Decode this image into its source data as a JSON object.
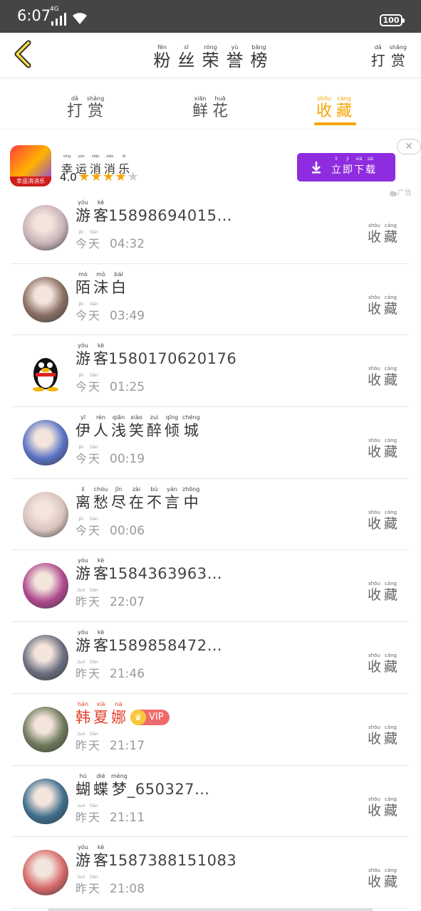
{
  "status_bar": {
    "time": "6:07",
    "network": "4G",
    "battery": "100"
  },
  "header": {
    "title": [
      {
        "py": "fěn",
        "hz": "粉"
      },
      {
        "py": "sī",
        "hz": "丝"
      },
      {
        "py": "róng",
        "hz": "荣"
      },
      {
        "py": "yù",
        "hz": "誉"
      },
      {
        "py": "bǎng",
        "hz": "榜"
      }
    ],
    "right_action": [
      {
        "py": "dǎ",
        "hz": "打"
      },
      {
        "py": "shǎng",
        "hz": "赏"
      }
    ]
  },
  "tabs": [
    {
      "chars": [
        {
          "py": "dǎ",
          "hz": "打"
        },
        {
          "py": "shǎng",
          "hz": "赏"
        }
      ],
      "active": false
    },
    {
      "chars": [
        {
          "py": "xiān",
          "hz": "鲜"
        },
        {
          "py": "huā",
          "hz": "花"
        }
      ],
      "active": false
    },
    {
      "chars": [
        {
          "py": "shōu",
          "hz": "收"
        },
        {
          "py": "cáng",
          "hz": "藏"
        }
      ],
      "active": true
    }
  ],
  "ad": {
    "icon_label": "幸运消消乐",
    "name": [
      {
        "py": "xìng",
        "hz": "幸"
      },
      {
        "py": "yùn",
        "hz": "运"
      },
      {
        "py": "xiāo",
        "hz": "消"
      },
      {
        "py": "xiāo",
        "hz": "消"
      },
      {
        "py": "lè",
        "hz": "乐"
      }
    ],
    "rating": "4.0",
    "stars_filled": 4,
    "stars_total": 5,
    "button": [
      {
        "py": "lì",
        "hz": "立"
      },
      {
        "py": "jí",
        "hz": "即"
      },
      {
        "py": "xià",
        "hz": "下"
      },
      {
        "py": "zài",
        "hz": "载"
      }
    ],
    "close": "✕",
    "tag": "广告"
  },
  "fav_label": [
    {
      "py": "shōu",
      "hz": "收"
    },
    {
      "py": "cáng",
      "hz": "藏"
    }
  ],
  "rows": [
    {
      "name_chars": [
        {
          "py": "yóu",
          "hz": "游"
        },
        {
          "py": "kè",
          "hz": "客"
        }
      ],
      "name_rest": "15898694015…",
      "day": [
        {
          "py": "jīn",
          "hz": "今"
        },
        {
          "py": "tiān",
          "hz": "天"
        }
      ],
      "time": "04:32",
      "avatar": "#c9b4b8",
      "vip": false,
      "red": false
    },
    {
      "name_chars": [
        {
          "py": "mò",
          "hz": "陌"
        },
        {
          "py": "mò",
          "hz": "沫"
        },
        {
          "py": "bái",
          "hz": "白"
        }
      ],
      "name_rest": "",
      "day": [
        {
          "py": "jīn",
          "hz": "今"
        },
        {
          "py": "tiān",
          "hz": "天"
        }
      ],
      "time": "03:49",
      "avatar": "#8a6f63",
      "vip": false,
      "red": false
    },
    {
      "name_chars": [
        {
          "py": "yóu",
          "hz": "游"
        },
        {
          "py": "kè",
          "hz": "客"
        }
      ],
      "name_rest": "1580170620176",
      "day": [
        {
          "py": "jīn",
          "hz": "今"
        },
        {
          "py": "tiān",
          "hz": "天"
        }
      ],
      "time": "01:25",
      "avatar": "qq",
      "vip": false,
      "red": false
    },
    {
      "name_chars": [
        {
          "py": "yī",
          "hz": "伊"
        },
        {
          "py": "rén",
          "hz": "人"
        },
        {
          "py": "qiǎn",
          "hz": "浅"
        },
        {
          "py": "xiào",
          "hz": "笑"
        },
        {
          "py": "zuì",
          "hz": "醉"
        },
        {
          "py": "qīng",
          "hz": "倾"
        },
        {
          "py": "chéng",
          "hz": "城"
        }
      ],
      "name_rest": "",
      "day": [
        {
          "py": "jīn",
          "hz": "今"
        },
        {
          "py": "tiān",
          "hz": "天"
        }
      ],
      "time": "00:19",
      "avatar": "#5a74c4",
      "vip": false,
      "red": false
    },
    {
      "name_chars": [
        {
          "py": "lí",
          "hz": "离"
        },
        {
          "py": "chóu",
          "hz": "愁"
        },
        {
          "py": "jǐn",
          "hz": "尽"
        },
        {
          "py": "zài",
          "hz": "在"
        },
        {
          "py": "bù",
          "hz": "不"
        },
        {
          "py": "yán",
          "hz": "言"
        },
        {
          "py": "zhōng",
          "hz": "中"
        }
      ],
      "name_rest": "",
      "day": [
        {
          "py": "jīn",
          "hz": "今"
        },
        {
          "py": "tiān",
          "hz": "天"
        }
      ],
      "time": "00:06",
      "avatar": "#d9c3bf",
      "vip": false,
      "red": false
    },
    {
      "name_chars": [
        {
          "py": "yóu",
          "hz": "游"
        },
        {
          "py": "kè",
          "hz": "客"
        }
      ],
      "name_rest": "1584363963…",
      "day": [
        {
          "py": "zuó",
          "hz": "昨"
        },
        {
          "py": "tiān",
          "hz": "天"
        }
      ],
      "time": "22:07",
      "avatar": "#b04a8e",
      "vip": false,
      "red": false
    },
    {
      "name_chars": [
        {
          "py": "yóu",
          "hz": "游"
        },
        {
          "py": "kè",
          "hz": "客"
        }
      ],
      "name_rest": "1589858472…",
      "day": [
        {
          "py": "zuó",
          "hz": "昨"
        },
        {
          "py": "tiān",
          "hz": "天"
        }
      ],
      "time": "21:46",
      "avatar": "#6b6f80",
      "vip": false,
      "red": false
    },
    {
      "name_chars": [
        {
          "py": "hán",
          "hz": "韩"
        },
        {
          "py": "xià",
          "hz": "夏"
        },
        {
          "py": "nà",
          "hz": "娜"
        }
      ],
      "name_rest": "",
      "day": [
        {
          "py": "zuó",
          "hz": "昨"
        },
        {
          "py": "tiān",
          "hz": "天"
        }
      ],
      "time": "21:17",
      "avatar": "#6f7a5c",
      "vip": true,
      "vip_label": "VIP",
      "red": true
    },
    {
      "name_chars": [
        {
          "py": "hú",
          "hz": "蝴"
        },
        {
          "py": "dié",
          "hz": "蝶"
        },
        {
          "py": "mèng",
          "hz": "梦"
        }
      ],
      "name_rest": "_650327…",
      "day": [
        {
          "py": "zuó",
          "hz": "昨"
        },
        {
          "py": "tiān",
          "hz": "天"
        }
      ],
      "time": "21:11",
      "avatar": "#3f6f8c",
      "vip": false,
      "red": false
    },
    {
      "name_chars": [
        {
          "py": "yóu",
          "hz": "游"
        },
        {
          "py": "kè",
          "hz": "客"
        }
      ],
      "name_rest": "1587388151083",
      "day": [
        {
          "py": "zuó",
          "hz": "昨"
        },
        {
          "py": "tiān",
          "hz": "天"
        }
      ],
      "time": "21:08",
      "avatar": "#d76a6a",
      "vip": false,
      "red": false
    }
  ]
}
